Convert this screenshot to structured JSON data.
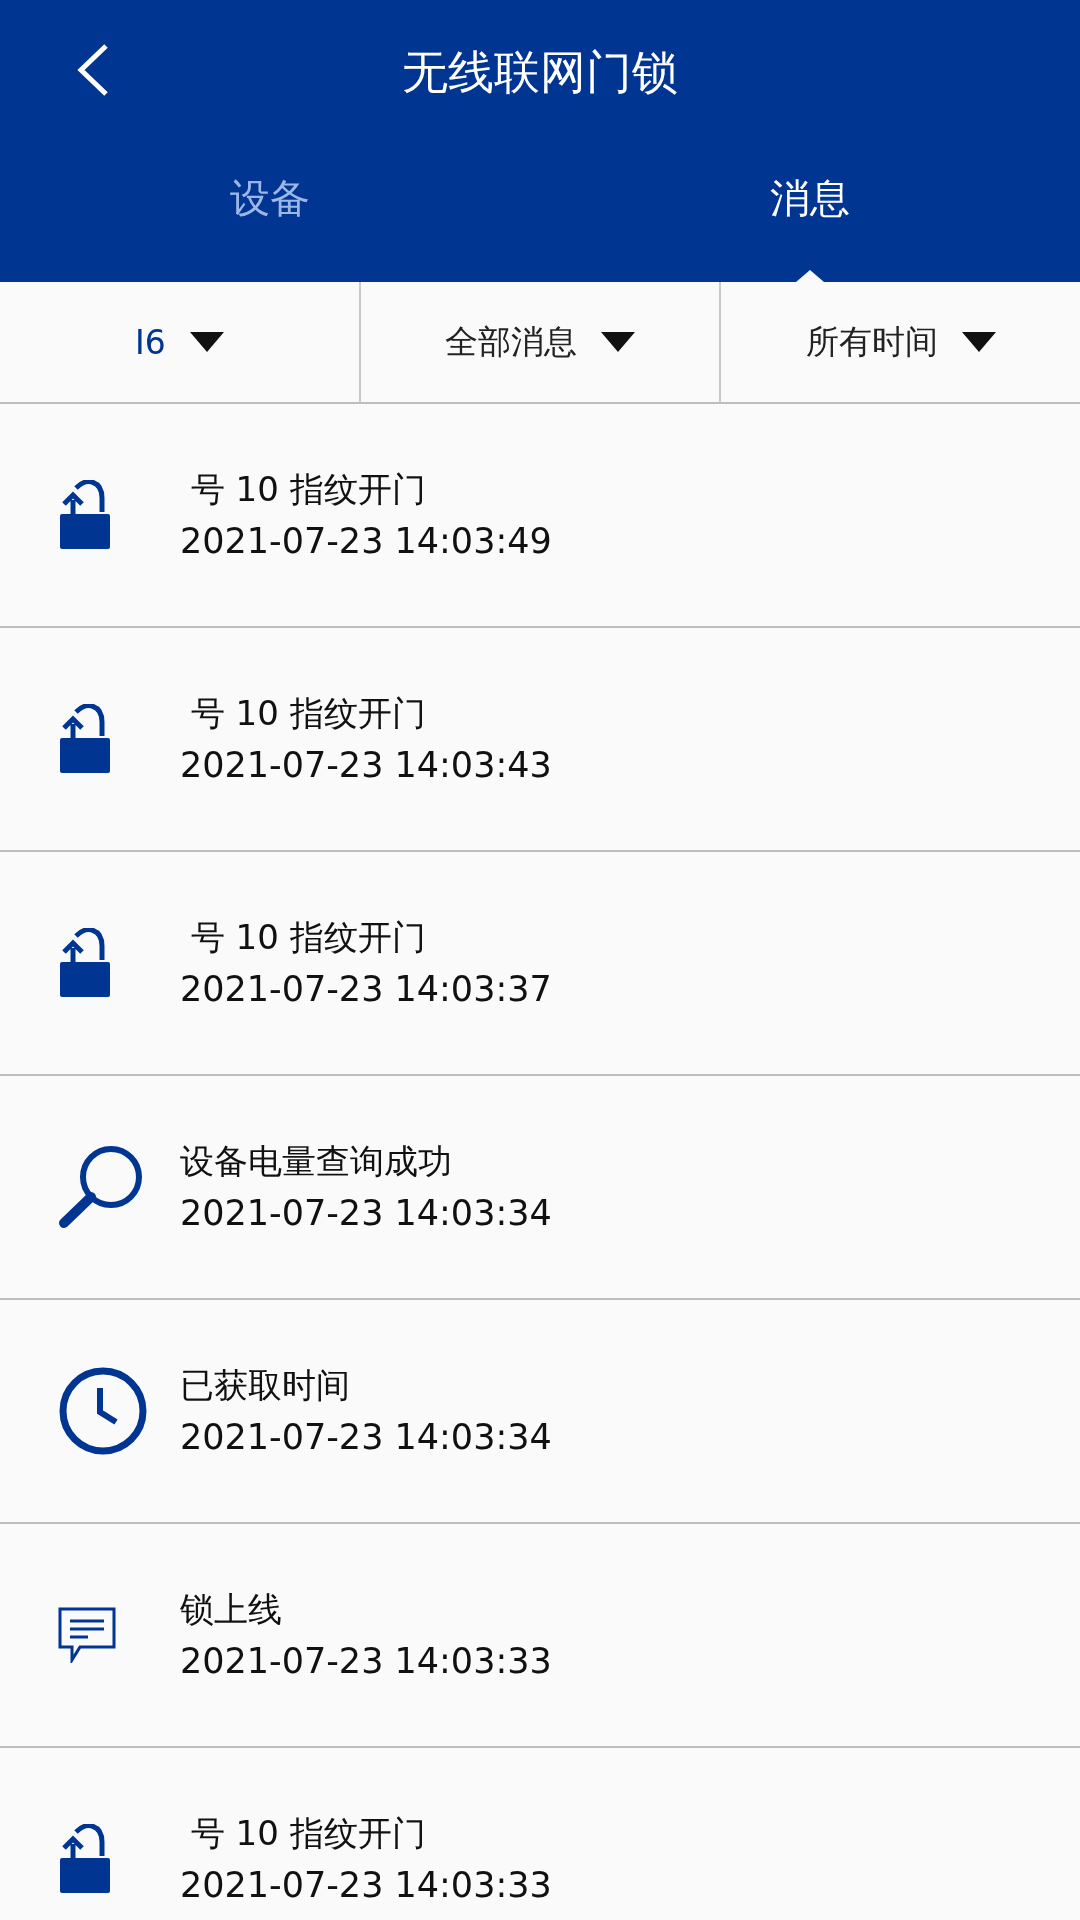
{
  "header": {
    "title": "无线联网门锁"
  },
  "tabs": [
    {
      "label": "设备",
      "selected": false
    },
    {
      "label": "消息",
      "selected": true
    }
  ],
  "filters": [
    {
      "label": "I6",
      "active": true
    },
    {
      "label": "全部消息",
      "active": false
    },
    {
      "label": "所有时间",
      "active": false
    }
  ],
  "messages": [
    {
      "kind": "unlock",
      "title": " 号 10 指纹开门",
      "time": "2021-07-23 14:03:49"
    },
    {
      "kind": "unlock",
      "title": " 号 10 指纹开门",
      "time": "2021-07-23 14:03:43"
    },
    {
      "kind": "unlock",
      "title": " 号 10 指纹开门",
      "time": "2021-07-23 14:03:37"
    },
    {
      "kind": "query",
      "title": "设备电量查询成功",
      "time": "2021-07-23 14:03:34"
    },
    {
      "kind": "clock",
      "title": "已获取时间",
      "time": "2021-07-23 14:03:34"
    },
    {
      "kind": "message",
      "title": "锁上线",
      "time": "2021-07-23 14:03:33"
    },
    {
      "kind": "unlock",
      "title": " 号 10 指纹开门",
      "time": "2021-07-23 14:03:33"
    }
  ]
}
